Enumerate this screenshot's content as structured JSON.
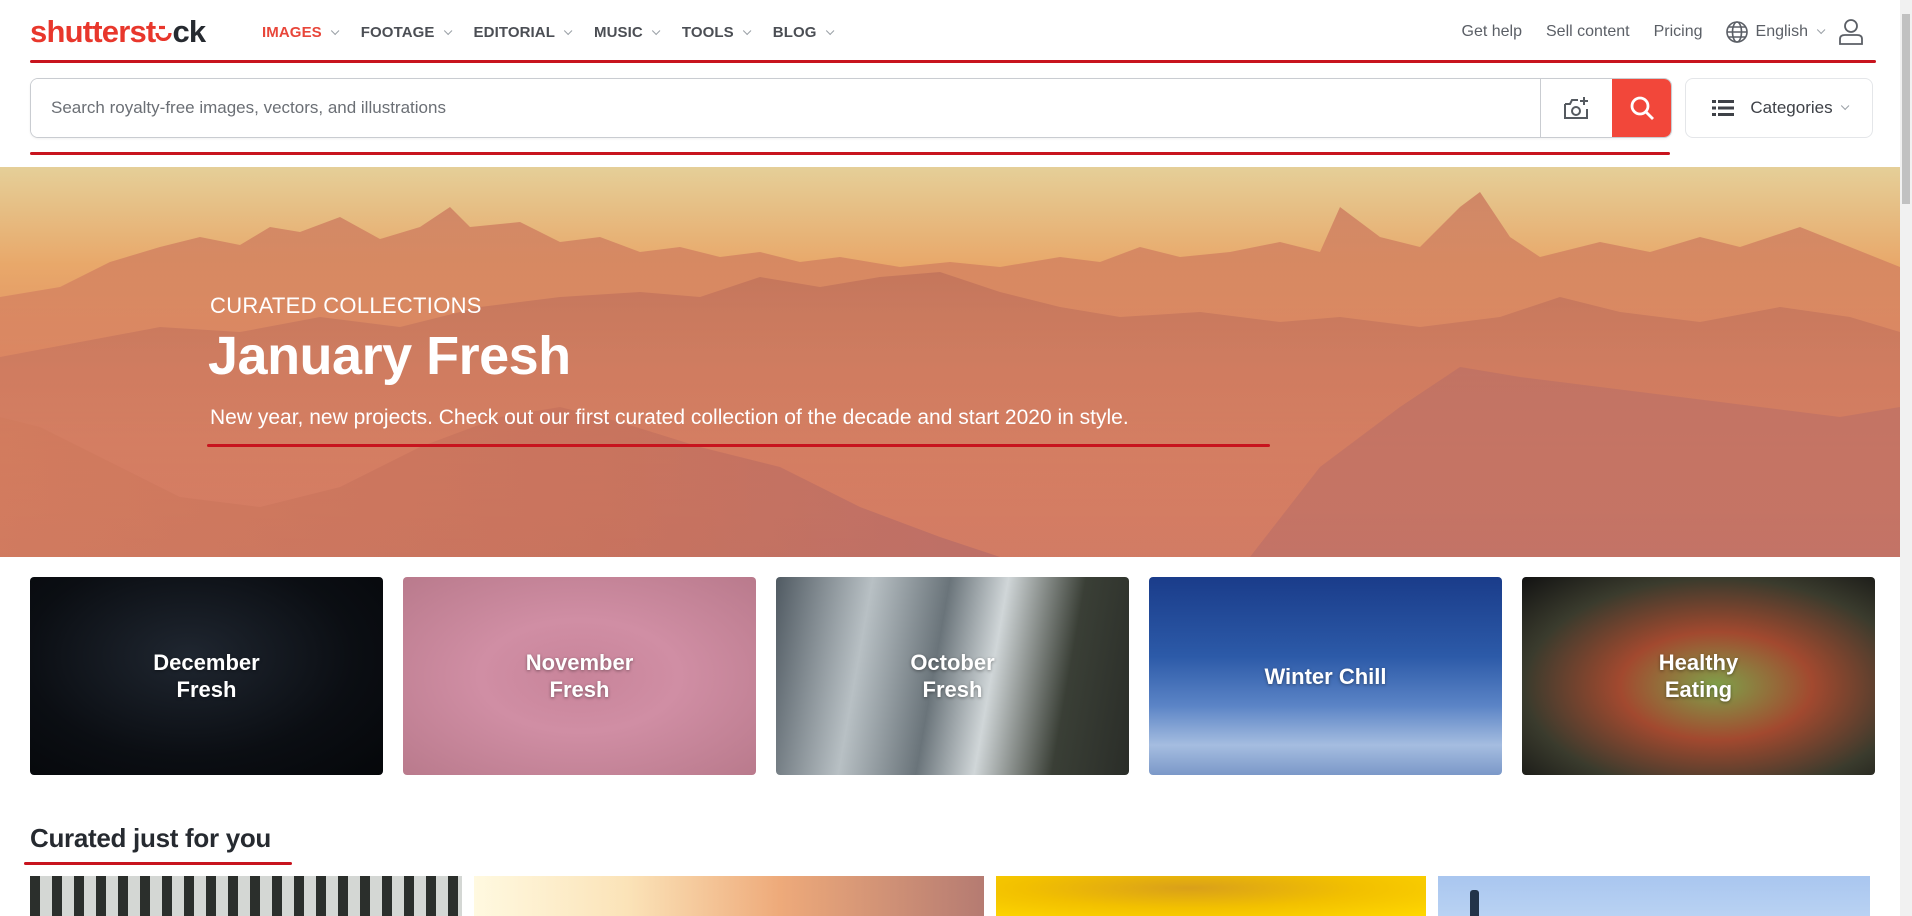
{
  "brand": {
    "logo_part1": "shutterst",
    "logo_part2": "o",
    "logo_part3": "ck",
    "accent_color": "#e8372c"
  },
  "nav": {
    "items": [
      {
        "label": "IMAGES",
        "active": true
      },
      {
        "label": "FOOTAGE",
        "active": false
      },
      {
        "label": "EDITORIAL",
        "active": false
      },
      {
        "label": "MUSIC",
        "active": false
      },
      {
        "label": "TOOLS",
        "active": false
      },
      {
        "label": "BLOG",
        "active": false
      }
    ],
    "right_links": [
      "Get help",
      "Sell content",
      "Pricing"
    ],
    "language": "English",
    "icons": {
      "language": "globe-icon",
      "account": "user-icon"
    }
  },
  "search": {
    "value": "",
    "placeholder": "Search royalty-free images, vectors, and illustrations",
    "camera_icon": "camera-plus-icon",
    "search_icon": "search-icon",
    "categories_label": "Categories",
    "categories_icon": "list-icon"
  },
  "hero": {
    "kicker": "CURATED COLLECTIONS",
    "title": "January Fresh",
    "description": "New year, new projects. Check out our first curated collection of the decade and start 2020 in style."
  },
  "collections": [
    {
      "label": "December\nFresh"
    },
    {
      "label": "November\nFresh"
    },
    {
      "label": "October\nFresh"
    },
    {
      "label": "Winter Chill"
    },
    {
      "label": "Healthy\nEating"
    }
  ],
  "curated": {
    "title": "Curated just for you",
    "thumbnails": [
      "building-facade",
      "warm-gradient",
      "sunflower-closeup",
      "blue-sky-tower"
    ]
  }
}
